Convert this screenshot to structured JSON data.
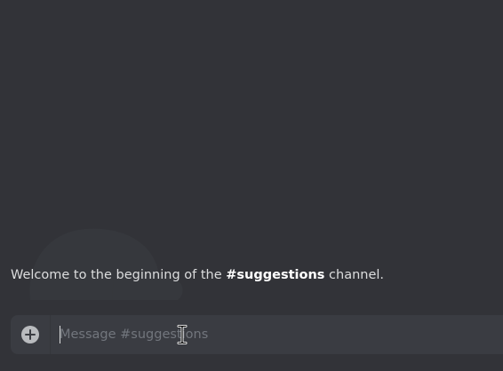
{
  "welcome": {
    "prefix": "Welcome to the beginning of the ",
    "channel": "#suggestions",
    "suffix": " channel."
  },
  "composer": {
    "placeholder": "Message #suggestions",
    "value": "",
    "attach_icon": "plus-circle-icon"
  },
  "colors": {
    "background": "#323338",
    "composer_bg": "#3a3c42",
    "text": "#dcddde",
    "placeholder": "#72767d",
    "icon": "#b9bbbe"
  }
}
